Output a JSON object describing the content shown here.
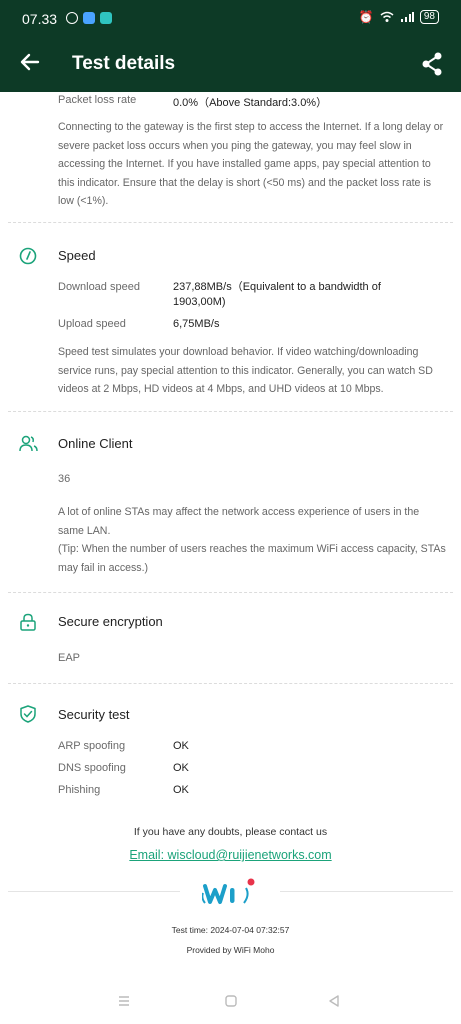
{
  "status_bar": {
    "time": "07.33",
    "battery": "98"
  },
  "header": {
    "title": "Test details"
  },
  "gateway": {
    "loss_label": "Packet loss rate",
    "loss_value": "0.0%（Above Standard:3.0%）",
    "description": "Connecting to the gateway is the first step to access the Internet. If a long delay or severe packet loss occurs when you ping the gateway, you may feel slow in accessing the Internet. If you have installed game apps, pay special attention to this indicator. Ensure that the delay is short (<50 ms) and the packet loss rate is low (<1%)."
  },
  "speed": {
    "title": "Speed",
    "download_label": "Download speed",
    "download_value": "237,88MB/s（Equivalent to a bandwidth of 1903,00M)",
    "upload_label": "Upload speed",
    "upload_value": "6,75MB/s",
    "description": "Speed test simulates your download behavior. If video watching/downloading service runs, pay special attention to this indicator. Generally, you can watch SD videos at 2 Mbps, HD videos at 4 Mbps, and UHD videos at 10 Mbps."
  },
  "online_client": {
    "title": "Online Client",
    "count": "36",
    "description": "A lot of online STAs may affect the network access experience of users in the same LAN.",
    "tip": "(Tip: When the number of users reaches the maximum WiFi access capacity, STAs may fail in access.)"
  },
  "encryption": {
    "title": "Secure encryption",
    "value": "EAP"
  },
  "security_test": {
    "title": "Security test",
    "items": [
      {
        "label": "ARP spoofing",
        "value": "OK"
      },
      {
        "label": "DNS spoofing",
        "value": "OK"
      },
      {
        "label": "Phishing",
        "value": "OK"
      }
    ]
  },
  "contact": {
    "text": "If you have any doubts, please contact us",
    "email": "Email: wiscloud@ruijienetworks.com"
  },
  "footer": {
    "test_time": "Test time: 2024-07-04 07:32:57",
    "provided_by": "Provided by WiFi Moho"
  },
  "colors": {
    "header_bg": "#0d3a26",
    "accent": "#1ba37a",
    "logo_red": "#e8334a"
  }
}
